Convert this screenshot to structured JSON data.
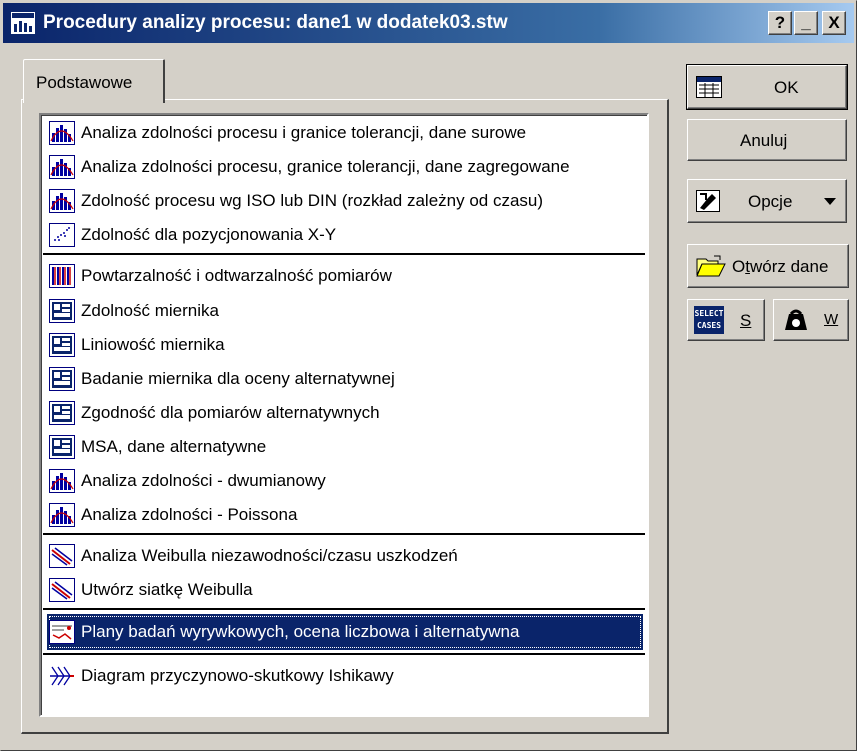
{
  "window": {
    "title": "Procedury analizy procesu: dane1 w dodatek03.stw",
    "help_label": "?",
    "minimize_label": "_",
    "close_label": "X"
  },
  "tabs": [
    {
      "label": "Podstawowe",
      "active": true
    }
  ],
  "list": {
    "items": [
      {
        "label": "Analiza zdolności procesu i granice tolerancji, dane surowe",
        "icon": "histogram-icon"
      },
      {
        "label": "Analiza zdolności procesu, granice tolerancji, dane zagregowane",
        "icon": "histogram-icon"
      },
      {
        "label": "Zdolność procesu wg ISO lub DIN (rozkład zależny od czasu)",
        "icon": "histogram-icon"
      },
      {
        "label": "Zdolność dla pozycjonowania X-Y",
        "icon": "scatter-icon"
      },
      {
        "label": "Powtarzalność i odtwarzalność pomiarów",
        "icon": "gauge-rr-icon"
      },
      {
        "label": "Zdolność miernika",
        "icon": "gauge-icon"
      },
      {
        "label": "Liniowość miernika",
        "icon": "gauge-icon"
      },
      {
        "label": "Badanie miernika dla oceny alternatywnej",
        "icon": "gauge-icon"
      },
      {
        "label": "Zgodność dla pomiarów alternatywnych",
        "icon": "gauge-icon"
      },
      {
        "label": "MSA, dane alternatywne",
        "icon": "gauge-icon"
      },
      {
        "label": "Analiza zdolności - dwumianowy",
        "icon": "histogram-icon"
      },
      {
        "label": "Analiza zdolności - Poissona",
        "icon": "histogram-icon"
      },
      {
        "label": "Analiza Weibulla niezawodności/czasu uszkodzeń",
        "icon": "weibull-icon"
      },
      {
        "label": "Utwórz siatkę Weibulla",
        "icon": "weibull-icon"
      },
      {
        "label": "Plany badań wyrywkowych, ocena liczbowa i alternatywna",
        "icon": "sampling-plan-icon",
        "selected": true
      },
      {
        "label": "Diagram przyczynowo-skutkowy Ishikawy",
        "icon": "fishbone-icon"
      }
    ]
  },
  "buttons": {
    "ok": "OK",
    "cancel": "Anuluj",
    "options": "Opcje",
    "open_data_prefix": "O",
    "open_data_underlined": "t",
    "open_data_suffix": "wórz dane",
    "select_cases_icon_text": "SELECT CASES",
    "select_cases_key": "S",
    "weight_key": "W"
  },
  "colors": {
    "selection": "#0a246a",
    "face": "#d4d0c8"
  }
}
